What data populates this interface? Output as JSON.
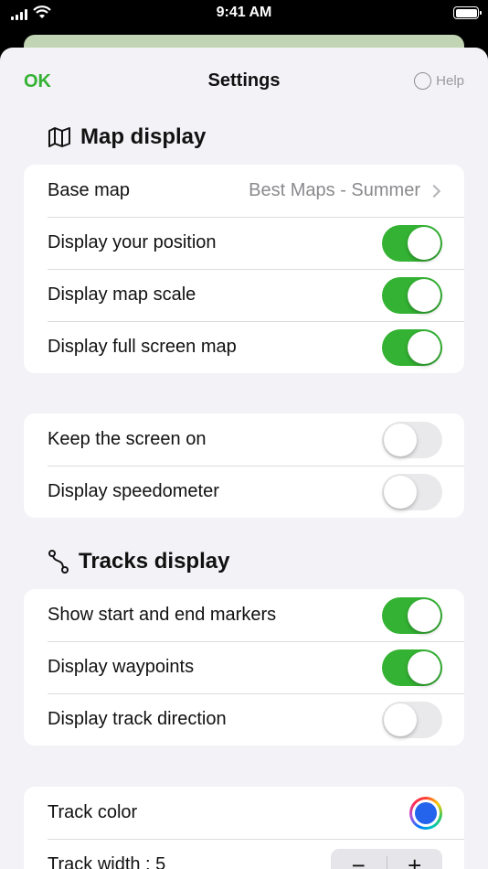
{
  "status_bar": {
    "time": "9:41 AM"
  },
  "nav": {
    "ok_label": "OK",
    "title": "Settings",
    "help_label": "Help"
  },
  "map_display": {
    "header": "Map display",
    "base_map": {
      "label": "Base map",
      "value": "Best Maps - Summer"
    },
    "rows": [
      {
        "label": "Display your position",
        "on": true
      },
      {
        "label": "Display map scale",
        "on": true
      },
      {
        "label": "Display full screen map",
        "on": true
      }
    ]
  },
  "screen": {
    "rows": [
      {
        "label": "Keep the screen on",
        "on": false
      },
      {
        "label": "Display speedometer",
        "on": false
      }
    ]
  },
  "tracks_display": {
    "header": "Tracks display",
    "rows": [
      {
        "label": "Show start and end markers",
        "on": true
      },
      {
        "label": "Display waypoints",
        "on": true
      },
      {
        "label": "Display track direction",
        "on": false
      }
    ]
  },
  "track_style": {
    "color_label": "Track color",
    "width_label": "Track width : 5",
    "stepper_minus": "−",
    "stepper_plus": "+"
  },
  "colors": {
    "accent": "#34b233",
    "toggle_off": "#e9e9eb",
    "track_color": "#2463eb"
  }
}
